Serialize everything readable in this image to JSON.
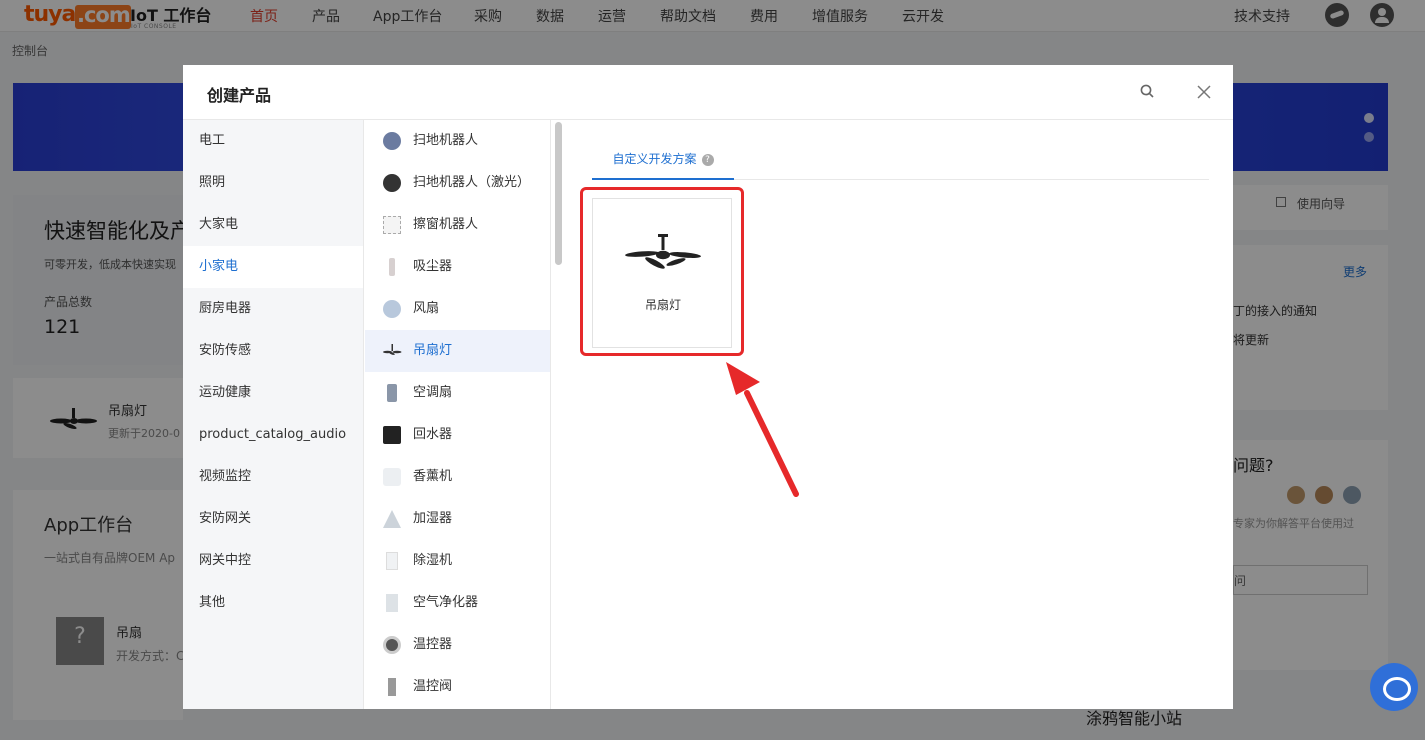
{
  "topnav": {
    "logo": "tuya.com",
    "console_title": "IoT 工作台",
    "console_sub": "IoT CONSOLE",
    "items": [
      "首页",
      "产品",
      "App工作台",
      "采购",
      "数据",
      "运营",
      "帮助文档",
      "费用",
      "增值服务",
      "云开发"
    ],
    "active_index": 0,
    "tech_support": "技术支持"
  },
  "breadcrumb": "控制台",
  "background": {
    "fast_title": "快速智能化及产",
    "fast_sub": "可零开发，低成本快速实现",
    "product_count_label": "产品总数",
    "product_count": "121",
    "fan_label": "吊扇灯",
    "fan_sub": "更新于2020-0",
    "app_ws_title": "App工作台",
    "app_ws_sub": "一站式自有品牌OEM Ap",
    "fan2_label": "吊扇",
    "fan2_sub": "开发方式：C",
    "guide": "使用向导",
    "more": "更多",
    "notice1": "丁的接入的通知",
    "notice2": "将更新",
    "question": "问题?",
    "expert": "专家为你解答平台使用过",
    "ask": "问",
    "station": "涂鸦智能小站"
  },
  "modal": {
    "title": "创建产品",
    "categories": [
      "电工",
      "照明",
      "大家电",
      "小家电",
      "厨房电器",
      "安防传感",
      "运动健康",
      "product_catalog_audio",
      "视频监控",
      "安防网关",
      "网关中控",
      "其他"
    ],
    "active_category": "小家电",
    "subcategories": [
      {
        "label": "扫地机器人",
        "icon": "robot-vacuum-icon"
      },
      {
        "label": "扫地机器人（激光）",
        "icon": "laser-robot-icon"
      },
      {
        "label": "擦窗机器人",
        "icon": "window-robot-icon"
      },
      {
        "label": "吸尘器",
        "icon": "vacuum-icon"
      },
      {
        "label": "风扇",
        "icon": "fan-icon"
      },
      {
        "label": "吊扇灯",
        "icon": "ceiling-fan-icon"
      },
      {
        "label": "空调扇",
        "icon": "air-cooler-icon"
      },
      {
        "label": "回水器",
        "icon": "water-return-icon"
      },
      {
        "label": "香薰机",
        "icon": "aroma-icon"
      },
      {
        "label": "加湿器",
        "icon": "humidifier-icon"
      },
      {
        "label": "除湿机",
        "icon": "dehumidifier-icon"
      },
      {
        "label": "空气净化器",
        "icon": "purifier-icon"
      },
      {
        "label": "温控器",
        "icon": "thermostat-icon"
      },
      {
        "label": "温控阀",
        "icon": "thermo-valve-icon"
      }
    ],
    "active_subcategory": "吊扇灯",
    "tab_label": "自定义开发方案",
    "tab_help": "?",
    "product_card": {
      "name": "吊扇灯",
      "icon": "ceiling-fan-icon"
    }
  },
  "colors": {
    "accent": "#1e6fd0",
    "brand": "#ff5a00",
    "nav_active": "#e23f2d",
    "annotation": "#e6292a"
  }
}
